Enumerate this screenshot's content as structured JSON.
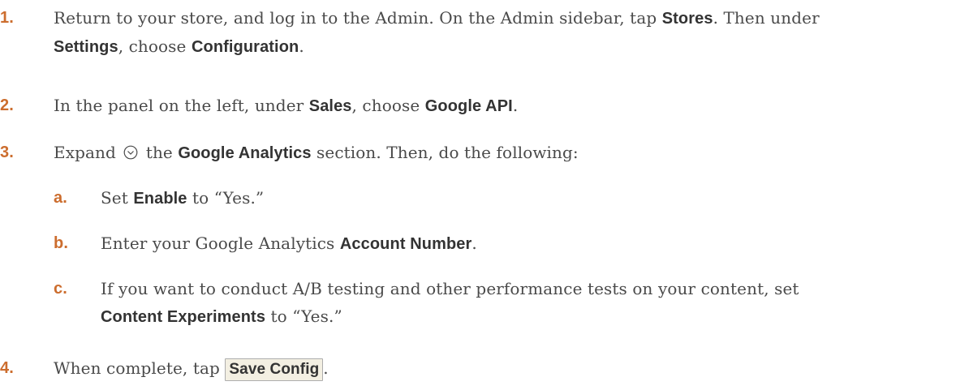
{
  "steps": [
    {
      "num": "1.",
      "line1_a": "Return to your store, and log in to the Admin. On the Admin sidebar, tap ",
      "line1_b": "Stores",
      "line1_c": ". Then under",
      "line2_a": "Settings",
      "line2_b": ", choose ",
      "line2_c": "Configuration",
      "line2_d": "."
    },
    {
      "num": "2.",
      "a": "In the panel on the left, under ",
      "b": "Sales",
      "c": ", choose ",
      "d": "Google API",
      "e": "."
    },
    {
      "num": "3.",
      "a": "Expand ",
      "b": " the ",
      "c": "Google Analytics",
      "d": " section. Then, do the following:"
    },
    {
      "num": "4.",
      "a": "When complete, tap ",
      "button": "Save Config",
      "b": "."
    }
  ],
  "substeps": [
    {
      "num": "a.",
      "a": "Set ",
      "b": "Enable",
      "c": " to “Yes.”"
    },
    {
      "num": "b.",
      "a": "Enter your Google Analytics ",
      "b": "Account Number",
      "c": "."
    },
    {
      "num": "c.",
      "line1": "If you want to conduct A/B testing and other performance tests on your content, set",
      "line2_a": "Content Experiments",
      "line2_b": " to “Yes.”"
    }
  ],
  "icons": {
    "expand": "chevron-circle-down-icon"
  },
  "colors": {
    "step_number": "#cc6d2e",
    "body_text": "#4a4a4a",
    "button_bg": "#f3efe2"
  }
}
